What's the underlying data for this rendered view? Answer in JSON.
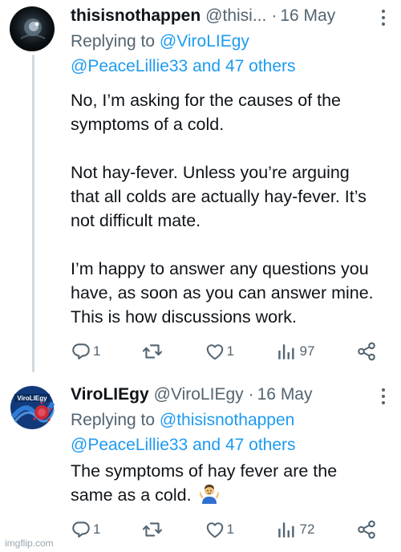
{
  "tweets": [
    {
      "name": "thisisnothappen",
      "handle": "@thisi...",
      "dot": "·",
      "date": "16 May",
      "replying_prefix": "Replying to",
      "replying_first": "@ViroLIEgy",
      "replying_second": "@PeaceLillie33 and 47 others",
      "paragraphs": [
        "No, I’m asking for the causes of the symptoms of a cold.",
        "Not hay-fever. Unless you’re arguing that all colds are actually hay-fever. It’s not difficult mate.",
        "I’m happy to answer any questions you have, as soon as you can answer mine. This is how discussions work."
      ],
      "reply_count": "1",
      "like_count": "1",
      "view_count": "97"
    },
    {
      "name": "ViroLIEgy",
      "handle": "@ViroLIEgy",
      "dot": "·",
      "date": "16 May",
      "replying_prefix": "Replying to",
      "replying_first": "@thisisnothappen",
      "replying_second": "@PeaceLillie33 and 47 others",
      "paragraphs": [
        "The symptoms of hay fever are the same as a cold."
      ],
      "emoji": "person-shrugging",
      "avatar_text": "ViroLIEgy",
      "reply_count": "1",
      "like_count": "1",
      "view_count": "72"
    }
  ],
  "icons": {
    "reply": "reply-icon",
    "retweet": "retweet-icon",
    "like": "heart-icon",
    "views": "views-icon",
    "share": "share-icon",
    "more": "more-icon"
  },
  "colors": {
    "text": "#0f1419",
    "secondary": "#536471",
    "link": "#1d9bf0",
    "thread_line": "#cfd9de"
  },
  "watermark": "imgflip.com"
}
